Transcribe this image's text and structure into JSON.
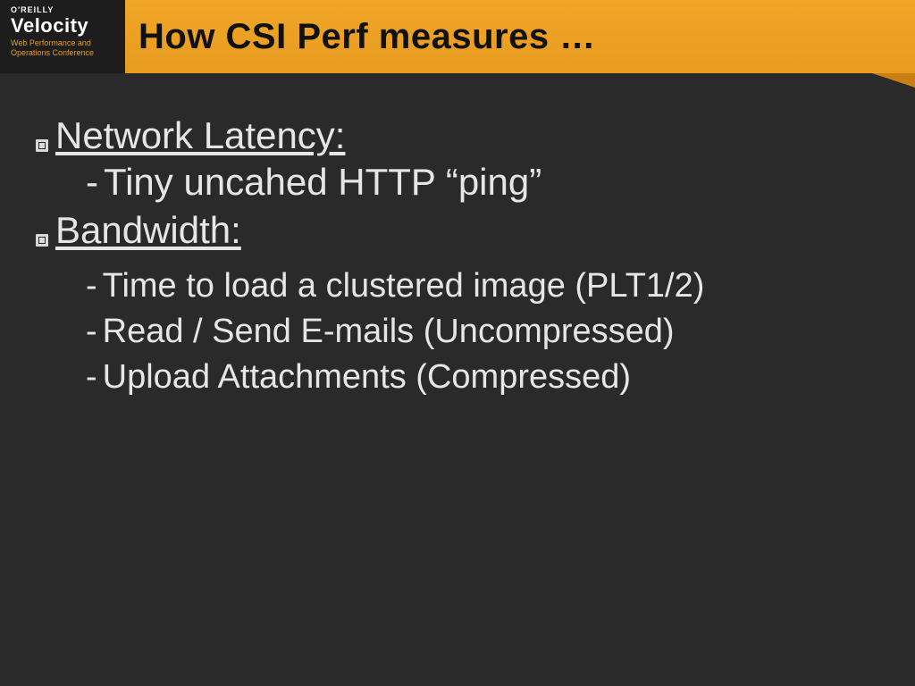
{
  "header": {
    "publisher": "O'REILLY",
    "brand": "Velocity",
    "tagline1": "Web Performance and",
    "tagline2": "Operations Conference",
    "title": "How CSI Perf measures …"
  },
  "sections": [
    {
      "label": "Network Latency:",
      "items": [
        "Tiny uncahed HTTP “ping”"
      ]
    },
    {
      "label": "Bandwidth:",
      "items": [
        "Time to load a clustered image (PLT1/2)",
        "Read / Send E-mails (Uncompressed)",
        "Upload Attachments (Compressed)"
      ]
    }
  ]
}
